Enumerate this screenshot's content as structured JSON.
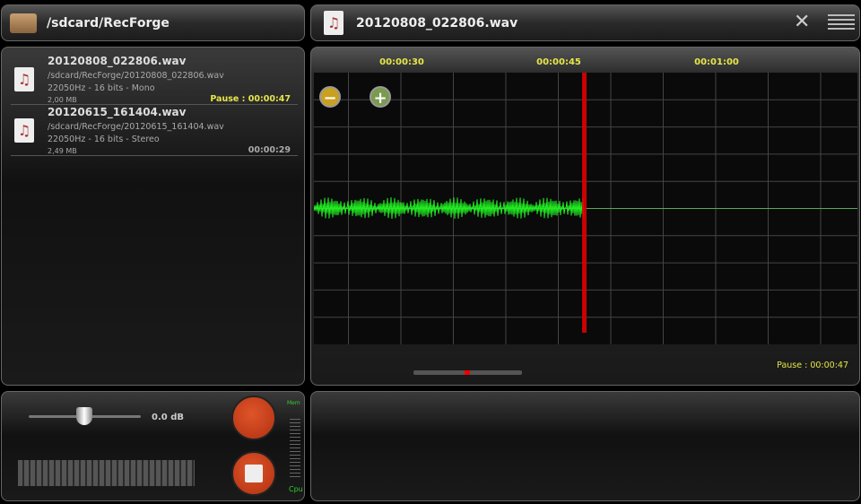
{
  "left_header": {
    "title": "/sdcard/RecForge",
    "icon": "folder-icon"
  },
  "right_header": {
    "title": "20120808_022806.wav",
    "icon": "music-file-icon"
  },
  "files": [
    {
      "name": "20120808_022806.wav",
      "path": "/sdcard/RecForge/20120808_022806.wav",
      "format": "22050Hz - 16 bits - Mono",
      "size": "2,00 MB",
      "status": "Pause : 00:00:47",
      "status_color": "#e6e64a"
    },
    {
      "name": "20120615_161404.wav",
      "path": "/sdcard/RecForge/20120615_161404.wav",
      "format": "22050Hz - 16 bits - Stereo",
      "size": "2,49 MB",
      "status": "00:00:29",
      "status_color": "#aaaaaa"
    }
  ],
  "timeline": {
    "labels": [
      "00:00:30",
      "00:00:45",
      "00:01:00"
    ],
    "status": "Pause : 00:00:47",
    "playhead_fraction": 0.5,
    "scroll_position": 0.5
  },
  "controls": {
    "gain": "0.0 dB",
    "gain_fraction": 0.5,
    "mem_label": "Mem",
    "cpu_label": "Cpu"
  }
}
